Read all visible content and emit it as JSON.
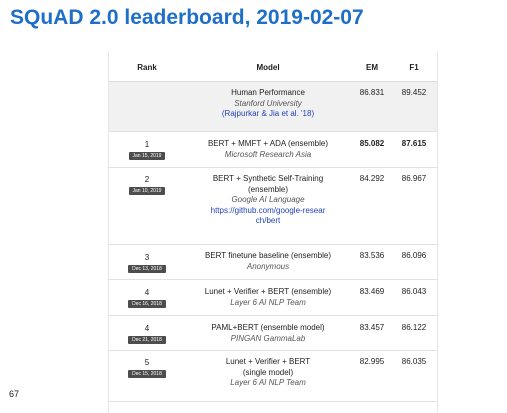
{
  "slide": {
    "title": "SQuAD 2.0 leaderboard, 2019-02-07",
    "page_number": "67"
  },
  "table": {
    "headers": {
      "rank": "Rank",
      "model": "Model",
      "em": "EM",
      "f1": "F1"
    },
    "human": {
      "name": "Human Performance",
      "org": "Stanford University",
      "link": "(Rajpurkar & Jia et al. '18)",
      "em": "86.831",
      "f1": "89.452"
    },
    "rows": [
      {
        "rank": "1",
        "date": "Jan 15, 2019",
        "name": "BERT + MMFT + ADA (ensemble)",
        "org": "Microsoft Research Asia",
        "link": "",
        "em": "85.082",
        "f1": "87.615"
      },
      {
        "rank": "2",
        "date": "Jan 10, 2019",
        "name": "BERT + Synthetic Self-Training (ensemble)",
        "org": "Google AI Language",
        "link": "https://github.com/google-research/bert",
        "em": "84.292",
        "f1": "86.967"
      },
      {
        "rank": "3",
        "date": "Dec 13, 2018",
        "name": "BERT finetune baseline (ensemble)",
        "org": "Anonymous",
        "link": "",
        "em": "83.536",
        "f1": "86.096"
      },
      {
        "rank": "4",
        "date": "Dec 16, 2018",
        "name": "Lunet + Verifier + BERT (ensemble)",
        "org": "Layer 6 AI NLP Team",
        "link": "",
        "em": "83.469",
        "f1": "86.043"
      },
      {
        "rank": "4",
        "date": "Dec 21, 2018",
        "name": "PAML+BERT (ensemble model)",
        "org": "PINGAN GammaLab",
        "link": "",
        "em": "83.457",
        "f1": "86.122"
      },
      {
        "rank": "5",
        "date": "Dec 15, 2018",
        "name": "Lunet + Verifier + BERT (single model)",
        "org": "Layer 6 AI NLP Team",
        "link": "",
        "em": "82.995",
        "f1": "86.035"
      }
    ]
  }
}
